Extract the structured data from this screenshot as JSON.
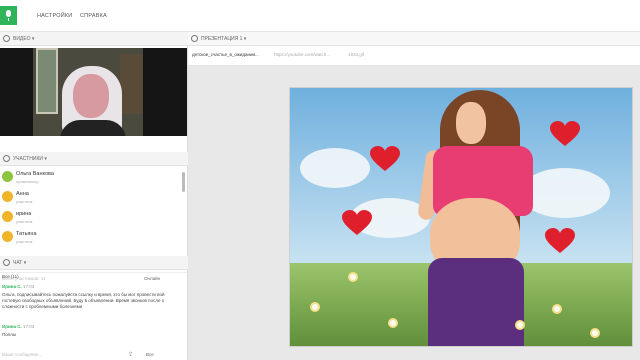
{
  "topbar": {
    "menu": [
      "НАСТРОЙКИ",
      "СПРАВКА"
    ]
  },
  "video_section": {
    "label": "ВИДЕО ▾"
  },
  "participants_section": {
    "label": "УЧАСТНИКИ ▾",
    "items": [
      {
        "name": "Ольга Ванкова",
        "status": "организатор"
      },
      {
        "name": "Анна",
        "status": "участник"
      },
      {
        "name": "ирина",
        "status": "участник"
      },
      {
        "name": "Татьяна",
        "status": "участник"
      }
    ],
    "invite_placeholder": "Всего участников: 11",
    "filter": "Онлайн"
  },
  "chat_section": {
    "label": "ЧАТ ▾",
    "tab": "Все (11)",
    "messages": [
      {
        "author": "Ирина С.",
        "time": "17:03",
        "text": "Ольга, подписывайтесь пожалуйста ссылку и время, кто бы мог провести вой гостевую свободных объявлений. Буду в объявлении. Время звонков после о сложности с проблемными болезнями"
      },
      {
        "author": "Ирина С.",
        "time": "17:03",
        "text": "Поллы"
      }
    ],
    "input_placeholder": "Ваше сообщение...",
    "recipient": "Все"
  },
  "presentation": {
    "label": "ПРЕЗЕНТАЦИЯ 1 ▾",
    "tabs": [
      {
        "title": "детское_счастье_в_ожидании..."
      },
      {
        "title": "https://youtube.com/watch..."
      },
      {
        "title": "1933.gif"
      }
    ]
  },
  "colors": {
    "brand_green": "#2fb45a",
    "heart_red": "#e01f2d",
    "shirt_pink": "#e83d72"
  }
}
